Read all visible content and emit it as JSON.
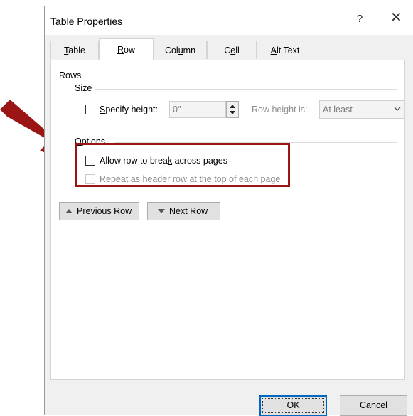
{
  "dialog": {
    "title": "Table Properties",
    "help_glyph": "?",
    "close_glyph": "✕"
  },
  "tabs": [
    {
      "label": "Table",
      "mnemonic": "T",
      "rest": "able",
      "active": false
    },
    {
      "label": "Row",
      "mnemonic": "R",
      "rest": "ow",
      "active": true
    },
    {
      "label": "Column",
      "pre": "Col",
      "mnemonic": "u",
      "rest": "mn",
      "active": false
    },
    {
      "label": "Cell",
      "pre": "C",
      "mnemonic": "e",
      "rest": "ll",
      "active": false
    },
    {
      "label": "Alt Text",
      "mnemonic": "A",
      "rest": "lt Text",
      "active": false
    }
  ],
  "rows_section": {
    "heading": "Rows",
    "size_heading": "Size",
    "specify_height": {
      "pre": "",
      "mnemonic": "S",
      "rest": "pecify height:",
      "checked": false
    },
    "height_value": "0\"",
    "row_height_is_label": "Row height is:",
    "row_height_is_value": "At least",
    "options_heading": {
      "mnemonic": "O",
      "rest": "ptions"
    },
    "allow_break": {
      "pre": "Allow row to brea",
      "mnemonic": "k",
      "rest": " across pages",
      "checked": false
    },
    "repeat_header": {
      "label": "Repeat as header row at the top of each page",
      "checked": false,
      "disabled": true
    }
  },
  "nav": {
    "previous": {
      "mnemonic": "P",
      "rest": "revious Row"
    },
    "next": {
      "mnemonic": "N",
      "rest": "ext Row"
    }
  },
  "buttons": {
    "ok": "OK",
    "cancel": "Cancel"
  },
  "annotation": {
    "arrow_color": "#9b1515",
    "highlight_color": "#9b1515"
  }
}
